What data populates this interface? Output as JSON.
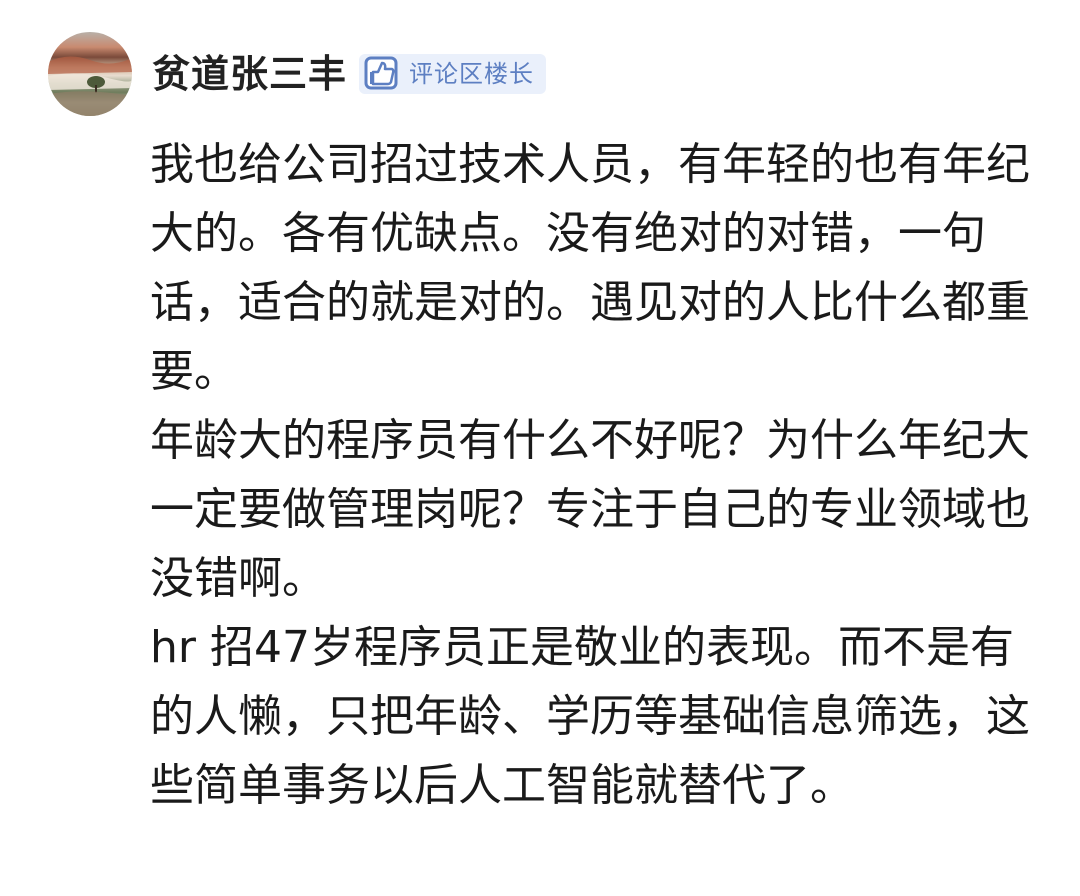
{
  "comment": {
    "author": {
      "name": "贫道张三丰",
      "badge_label": "评论区楼长",
      "badge_icon": "thumbs-up-icon",
      "avatar_icon": "landscape-avatar"
    },
    "paragraphs": [
      "我也给公司招过技术人员，有年轻的也有年纪大的。各有优缺点。没有绝对的对错，一句话，适合的就是对的。遇见对的人比什么都重要。",
      "年龄大的程序员有什么不好呢？为什么年纪大一定要做管理岗呢？专注于自己的专业领域也没错啊。",
      "hr 招47岁程序员正是敬业的表现。而不是有的人懒，只把年龄、学历等基础信息筛选，这些简单事务以后人工智能就替代了。"
    ]
  },
  "colors": {
    "badge_bg": "#eaf0fb",
    "badge_text": "#5d7fc2",
    "text": "#1a1a1a"
  }
}
